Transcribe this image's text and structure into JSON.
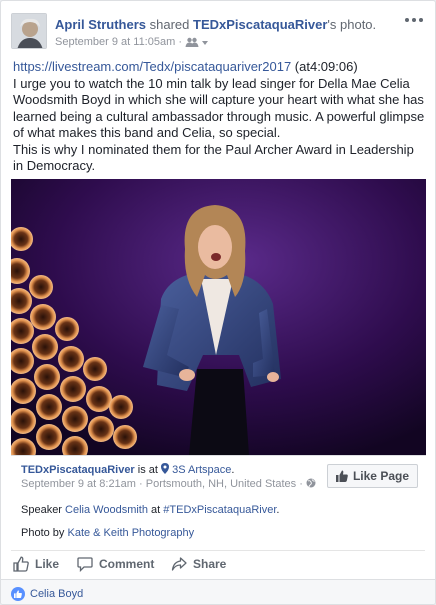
{
  "post": {
    "author": "April Struthers",
    "shared_text": " shared ",
    "page_link": "TEDxPiscataquaRiver",
    "photo_suffix": "'s photo.",
    "time": "September 9 at 11:05am",
    "dot": " · ",
    "link_text": "https://livestream.com/Tedx/piscataquariver2017",
    "at_time": " (at4:09:06)",
    "body1": "I urge you to watch the 10 min talk by lead singer for Della Mae Celia Woodsmith Boyd in which she will capture your heart with what she has learned being a cultural ambassador through music. A powerful glimpse of what makes this band and Celia, so special.",
    "body2": "This is why I nominated them for the Paul Archer Award in Leadership in Democracy."
  },
  "shared_card": {
    "page_name": "TEDxPiscataquaRiver",
    "is_at": " is at ",
    "location": "3S Artspace",
    "period": ".",
    "time": "September 9 at 8:21am",
    "place": " · Portsmouth, NH, United States · ",
    "speaker_pre": "Speaker ",
    "speaker_name": "Celia Woodsmith",
    "speaker_at": " at ",
    "hashtag": "#TEDxPiscataquaRiver",
    "speaker_end": ".",
    "photo_pre": "Photo by ",
    "photographer": "Kate & Keith Photography",
    "like_page_label": "Like Page"
  },
  "actions": {
    "like": "Like",
    "comment": "Comment",
    "share": "Share"
  },
  "reactions": {
    "names": "Celia Boyd"
  },
  "colors": {
    "link": "#365899",
    "meta": "#90949c",
    "stage_purple": "#3b0f5e",
    "reaction_blue": "#5890ff"
  }
}
